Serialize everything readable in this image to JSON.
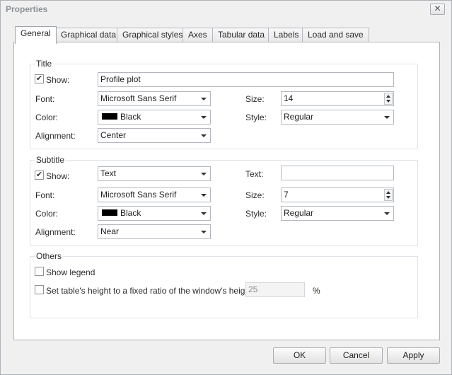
{
  "window": {
    "title": "Properties",
    "close_glyph": "✕"
  },
  "tabs": [
    {
      "label": "General",
      "active": true
    },
    {
      "label": "Graphical data"
    },
    {
      "label": "Graphical styles"
    },
    {
      "label": "Axes"
    },
    {
      "label": "Tabular data"
    },
    {
      "label": "Labels"
    },
    {
      "label": "Load and save"
    }
  ],
  "title_group": {
    "label": "Title",
    "show_label": "Show:",
    "show_checked": true,
    "text_value": "Profile plot",
    "font_label": "Font:",
    "font_value": "Microsoft Sans Serif",
    "size_label": "Size:",
    "size_value": "14",
    "color_label": "Color:",
    "color_value": "Black",
    "color_hex": "#000000",
    "style_label": "Style:",
    "style_value": "Regular",
    "alignment_label": "Alignment:",
    "alignment_value": "Center"
  },
  "subtitle_group": {
    "label": "Subtitle",
    "show_label": "Show:",
    "show_checked": true,
    "show_mode_value": "Text",
    "text_label": "Text:",
    "text_value": "",
    "font_label": "Font:",
    "font_value": "Microsoft Sans Serif",
    "size_label": "Size:",
    "size_value": "7",
    "color_label": "Color:",
    "color_value": "Black",
    "color_hex": "#000000",
    "style_label": "Style:",
    "style_value": "Regular",
    "alignment_label": "Alignment:",
    "alignment_value": "Near"
  },
  "others_group": {
    "label": "Others",
    "show_legend_label": "Show legend",
    "show_legend_checked": false,
    "fixed_ratio_label": "Set table's height to a fixed ratio of the window's height",
    "fixed_ratio_checked": false,
    "ratio_value": "25",
    "ratio_unit": "%"
  },
  "buttons": {
    "ok": "OK",
    "cancel": "Cancel",
    "apply": "Apply"
  }
}
